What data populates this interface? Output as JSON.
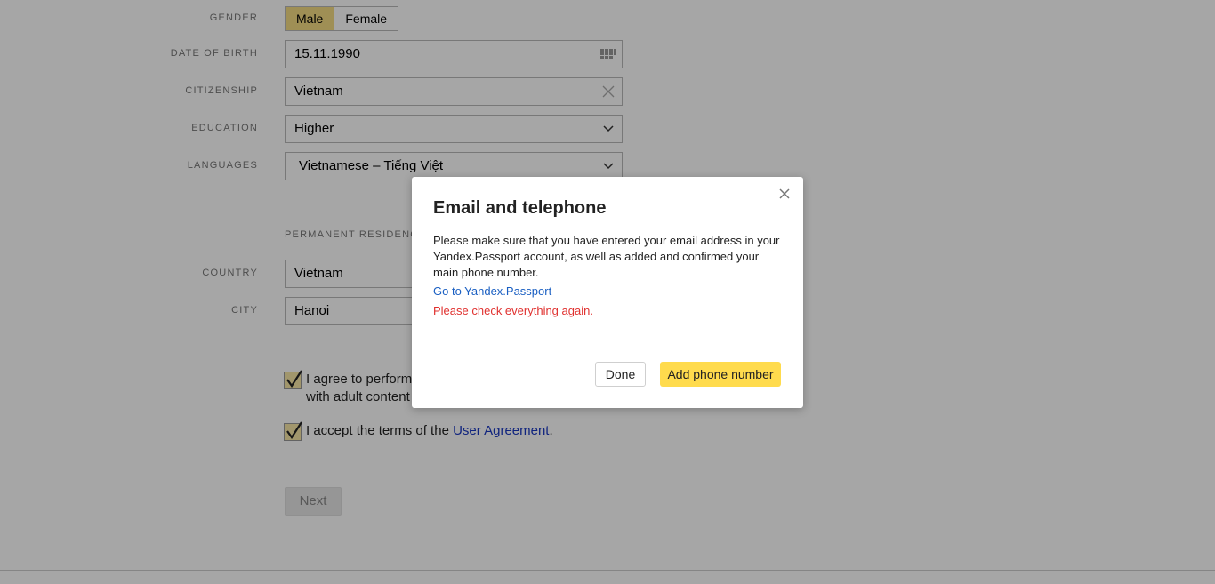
{
  "form": {
    "gender": {
      "label": "GENDER",
      "options": [
        "Male",
        "Female"
      ],
      "selected": "Male"
    },
    "dob": {
      "label": "DATE OF BIRTH",
      "value": "15.11.1990"
    },
    "citizenship": {
      "label": "CITIZENSHIP",
      "value": "Vietnam"
    },
    "education": {
      "label": "EDUCATION",
      "value": "Higher"
    },
    "languages": {
      "label": "LANGUAGES",
      "value": "Vietnamese – Tiếng Việt"
    },
    "residence_title": "PERMANENT RESIDENCE",
    "country": {
      "label": "COUNTRY",
      "value": "Vietnam"
    },
    "city": {
      "label": "CITY",
      "value": "Hanoi"
    },
    "agree_adult": {
      "line1": "I agree to perform tasks",
      "line2": "with adult content"
    },
    "accept_terms": {
      "prefix": "I accept the terms of the ",
      "link": "User Agreement",
      "suffix": "."
    },
    "next_label": "Next"
  },
  "modal": {
    "title": "Email and telephone",
    "body": "Please make sure that you have entered your email address in your Yandex.Passport account, as well as added and confirmed your main phone number.",
    "link": "Go to Yandex.Passport",
    "error": "Please check everything again.",
    "done_label": "Done",
    "add_label": "Add phone number"
  },
  "colors": {
    "accent": "#ffdb4d",
    "error": "#e0312f",
    "link": "#1a5fc2"
  },
  "icons": {
    "calendar": "calendar-icon",
    "clear": "clear-icon",
    "dropdown": "chevron-down-icon",
    "close": "close-icon"
  }
}
